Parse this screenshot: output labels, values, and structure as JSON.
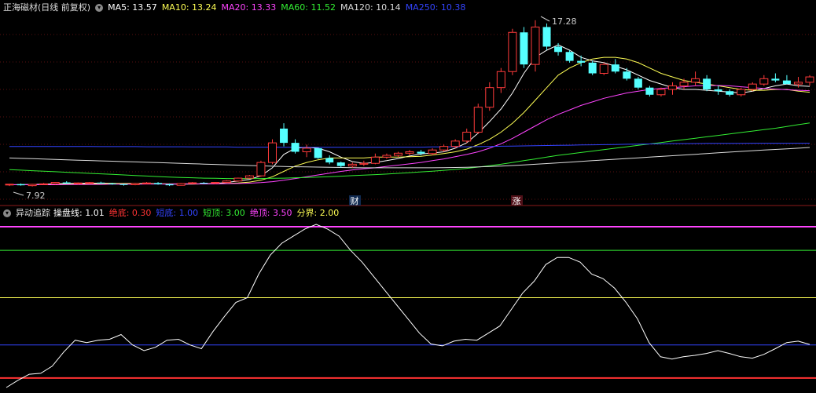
{
  "main_panel": {
    "title": "正海磁材(日线 前复权)",
    "indicators": [
      {
        "label": "MA5: 13.57",
        "color": "#ffffff"
      },
      {
        "label": "MA10: 13.24",
        "color": "#ffff55"
      },
      {
        "label": "MA20: 13.33",
        "color": "#ff44ff"
      },
      {
        "label": "MA60: 11.52",
        "color": "#33ee33"
      },
      {
        "label": "MA120: 10.14",
        "color": "#dddddd"
      },
      {
        "label": "MA250: 10.38",
        "color": "#3344ff"
      }
    ],
    "max_price_label": "17.28",
    "min_price_label": "7.92",
    "marker_cai": "财",
    "marker_zhang": "涨"
  },
  "sub_panel": {
    "title": "异动追踪",
    "indicators": [
      {
        "label": "操盘线: 1.01",
        "color": "#ffffff"
      },
      {
        "label": "绝底: 0.30",
        "color": "#ff3333"
      },
      {
        "label": "短底: 1.00",
        "color": "#3344ff"
      },
      {
        "label": "短顶: 3.00",
        "color": "#33ee33"
      },
      {
        "label": "绝顶: 3.50",
        "color": "#ff44ff"
      },
      {
        "label": "分界: 2.00",
        "color": "#ffff55"
      }
    ]
  },
  "chart_data": [
    {
      "type": "candlestick",
      "title": "正海磁材(日线 前复权)",
      "ylim": [
        7.5,
        17.8
      ],
      "candles": [
        [
          8.05,
          8.1,
          7.98,
          8.08
        ],
        [
          8.08,
          8.12,
          8.0,
          8.02
        ],
        [
          8.0,
          8.1,
          7.95,
          8.07
        ],
        [
          8.07,
          8.15,
          8.03,
          8.1
        ],
        [
          8.1,
          8.2,
          8.05,
          8.18
        ],
        [
          8.18,
          8.25,
          8.1,
          8.12
        ],
        [
          8.12,
          8.18,
          8.05,
          8.15
        ],
        [
          8.15,
          8.2,
          8.1,
          8.17
        ],
        [
          8.17,
          8.22,
          8.1,
          8.12
        ],
        [
          8.12,
          8.16,
          8.05,
          8.08
        ],
        [
          8.08,
          8.12,
          8.0,
          8.05
        ],
        [
          8.05,
          8.15,
          8.02,
          8.12
        ],
        [
          8.12,
          8.2,
          8.08,
          8.15
        ],
        [
          8.15,
          8.2,
          8.05,
          8.08
        ],
        [
          8.08,
          8.12,
          7.98,
          8.02
        ],
        [
          8.02,
          8.15,
          8.0,
          8.12
        ],
        [
          8.12,
          8.2,
          8.08,
          8.16
        ],
        [
          8.16,
          8.2,
          8.1,
          8.14
        ],
        [
          8.14,
          8.2,
          8.08,
          8.18
        ],
        [
          8.18,
          8.3,
          8.15,
          8.26
        ],
        [
          8.26,
          8.45,
          8.22,
          8.42
        ],
        [
          8.42,
          8.6,
          8.38,
          8.55
        ],
        [
          8.55,
          9.4,
          8.5,
          9.3
        ],
        [
          9.3,
          10.6,
          9.2,
          10.4
        ],
        [
          11.2,
          11.5,
          10.2,
          10.4
        ],
        [
          10.4,
          10.6,
          9.8,
          9.9
        ],
        [
          9.9,
          10.3,
          9.6,
          10.1
        ],
        [
          10.1,
          10.1,
          9.5,
          9.55
        ],
        [
          9.55,
          9.7,
          9.2,
          9.3
        ],
        [
          9.3,
          9.35,
          9.0,
          9.1
        ],
        [
          9.1,
          9.3,
          9.0,
          9.2
        ],
        [
          9.2,
          9.4,
          9.1,
          9.25
        ],
        [
          9.25,
          9.8,
          9.2,
          9.6
        ],
        [
          9.6,
          9.8,
          9.5,
          9.7
        ],
        [
          9.7,
          9.9,
          9.6,
          9.82
        ],
        [
          9.82,
          10.0,
          9.7,
          9.9
        ],
        [
          9.9,
          10.0,
          9.7,
          9.8
        ],
        [
          9.8,
          10.1,
          9.7,
          10.0
        ],
        [
          10.0,
          10.3,
          9.9,
          10.2
        ],
        [
          10.2,
          10.6,
          10.1,
          10.5
        ],
        [
          10.5,
          11.2,
          10.4,
          11.0
        ],
        [
          11.0,
          12.6,
          10.9,
          12.4
        ],
        [
          12.4,
          13.8,
          12.2,
          13.5
        ],
        [
          13.5,
          14.6,
          13.2,
          14.4
        ],
        [
          14.4,
          16.8,
          14.2,
          16.6
        ],
        [
          16.6,
          16.9,
          14.6,
          14.8
        ],
        [
          14.8,
          17.28,
          14.4,
          16.9
        ],
        [
          16.9,
          17.1,
          15.6,
          15.8
        ],
        [
          15.8,
          16.0,
          15.3,
          15.5
        ],
        [
          15.5,
          15.6,
          14.9,
          15.0
        ],
        [
          15.0,
          15.3,
          14.7,
          14.9
        ],
        [
          14.9,
          15.0,
          14.2,
          14.3
        ],
        [
          14.3,
          14.9,
          14.2,
          14.8
        ],
        [
          14.8,
          15.1,
          14.3,
          14.4
        ],
        [
          14.4,
          14.6,
          13.9,
          14.0
        ],
        [
          14.0,
          14.1,
          13.4,
          13.5
        ],
        [
          13.5,
          13.6,
          13.0,
          13.1
        ],
        [
          13.1,
          13.5,
          13.0,
          13.4
        ],
        [
          13.4,
          13.8,
          13.1,
          13.6
        ],
        [
          13.6,
          14.0,
          13.4,
          13.8
        ],
        [
          13.8,
          14.4,
          13.6,
          14.0
        ],
        [
          14.0,
          14.2,
          13.3,
          13.4
        ],
        [
          13.4,
          13.6,
          13.1,
          13.3
        ],
        [
          13.3,
          13.4,
          13.0,
          13.1
        ],
        [
          13.1,
          13.5,
          13.0,
          13.4
        ],
        [
          13.4,
          13.8,
          13.3,
          13.7
        ],
        [
          13.7,
          14.2,
          13.6,
          14.0
        ],
        [
          14.0,
          14.3,
          13.8,
          13.9
        ],
        [
          13.9,
          14.2,
          13.7,
          13.7
        ],
        [
          13.7,
          14.1,
          13.5,
          13.8
        ],
        [
          13.8,
          14.2,
          13.6,
          14.1
        ]
      ],
      "series": [
        {
          "name": "MA5",
          "color": "#ffffff",
          "values": [
            8.05,
            8.06,
            8.07,
            8.08,
            8.1,
            8.12,
            8.13,
            8.14,
            8.14,
            8.13,
            8.1,
            8.1,
            8.1,
            8.1,
            8.08,
            8.08,
            8.08,
            8.1,
            8.12,
            8.18,
            8.26,
            8.35,
            8.55,
            9.0,
            9.75,
            10.1,
            10.15,
            10.1,
            9.9,
            9.6,
            9.35,
            9.25,
            9.3,
            9.4,
            9.52,
            9.66,
            9.78,
            9.83,
            9.9,
            10.1,
            10.4,
            10.95,
            11.6,
            12.3,
            13.2,
            14.3,
            15.2,
            15.6,
            15.9,
            15.6,
            15.2,
            15.0,
            14.9,
            14.7,
            14.5,
            14.2,
            13.9,
            13.7,
            13.5,
            13.4,
            13.4,
            13.35,
            13.3,
            13.25,
            13.2,
            13.3,
            13.45,
            13.6,
            13.7,
            13.6,
            13.57
          ]
        },
        {
          "name": "MA10",
          "color": "#ffff55",
          "values": [
            8.05,
            8.05,
            8.05,
            8.06,
            8.07,
            8.08,
            8.09,
            8.1,
            8.11,
            8.12,
            8.12,
            8.12,
            8.12,
            8.11,
            8.1,
            8.1,
            8.1,
            8.1,
            8.11,
            8.12,
            8.15,
            8.2,
            8.3,
            8.5,
            8.8,
            9.1,
            9.3,
            9.45,
            9.55,
            9.55,
            9.55,
            9.55,
            9.6,
            9.6,
            9.6,
            9.62,
            9.65,
            9.72,
            9.8,
            9.9,
            10.05,
            10.3,
            10.6,
            11.0,
            11.5,
            12.1,
            12.8,
            13.5,
            14.2,
            14.6,
            14.9,
            15.1,
            15.2,
            15.2,
            15.1,
            14.9,
            14.6,
            14.3,
            14.1,
            13.9,
            13.8,
            13.7,
            13.6,
            13.5,
            13.4,
            13.35,
            13.35,
            13.4,
            13.4,
            13.3,
            13.24
          ]
        },
        {
          "name": "MA20",
          "color": "#ff44ff",
          "values": [
            8.05,
            8.05,
            8.05,
            8.05,
            8.05,
            8.06,
            8.06,
            8.07,
            8.07,
            8.08,
            8.08,
            8.08,
            8.09,
            8.09,
            8.09,
            8.1,
            8.1,
            8.1,
            8.1,
            8.11,
            8.12,
            8.14,
            8.17,
            8.22,
            8.3,
            8.4,
            8.5,
            8.6,
            8.7,
            8.8,
            8.88,
            8.95,
            9.0,
            9.08,
            9.15,
            9.22,
            9.3,
            9.4,
            9.5,
            9.62,
            9.75,
            9.9,
            10.1,
            10.35,
            10.65,
            11.0,
            11.35,
            11.7,
            12.0,
            12.25,
            12.5,
            12.7,
            12.9,
            13.05,
            13.2,
            13.3,
            13.4,
            13.45,
            13.5,
            13.55,
            13.6,
            13.62,
            13.62,
            13.6,
            13.55,
            13.5,
            13.45,
            13.42,
            13.38,
            13.35,
            13.33
          ]
        },
        {
          "name": "MA60",
          "color": "#33ee33",
          "values": [
            8.9,
            8.87,
            8.84,
            8.81,
            8.78,
            8.75,
            8.72,
            8.69,
            8.66,
            8.63,
            8.6,
            8.57,
            8.54,
            8.51,
            8.48,
            8.46,
            8.44,
            8.42,
            8.41,
            8.4,
            8.4,
            8.4,
            8.4,
            8.41,
            8.42,
            8.44,
            8.46,
            8.48,
            8.5,
            8.53,
            8.56,
            8.59,
            8.62,
            8.65,
            8.69,
            8.73,
            8.77,
            8.81,
            8.86,
            8.91,
            8.97,
            9.04,
            9.12,
            9.2,
            9.3,
            9.4,
            9.5,
            9.6,
            9.7,
            9.78,
            9.86,
            9.94,
            10.02,
            10.1,
            10.18,
            10.26,
            10.34,
            10.42,
            10.5,
            10.58,
            10.66,
            10.74,
            10.82,
            10.9,
            10.98,
            11.06,
            11.14,
            11.22,
            11.32,
            11.42,
            11.52
          ]
        },
        {
          "name": "MA120",
          "color": "#dddddd",
          "values": [
            9.55,
            9.53,
            9.51,
            9.49,
            9.47,
            9.45,
            9.43,
            9.41,
            9.39,
            9.37,
            9.35,
            9.33,
            9.31,
            9.29,
            9.27,
            9.25,
            9.23,
            9.21,
            9.19,
            9.17,
            9.15,
            9.13,
            9.11,
            9.09,
            9.07,
            9.06,
            9.05,
            9.04,
            9.03,
            9.02,
            9.01,
            9.0,
            9.0,
            9.0,
            9.0,
            9.0,
            9.0,
            9.0,
            9.01,
            9.02,
            9.03,
            9.05,
            9.07,
            9.1,
            9.13,
            9.16,
            9.2,
            9.24,
            9.28,
            9.32,
            9.36,
            9.4,
            9.44,
            9.48,
            9.52,
            9.56,
            9.6,
            9.64,
            9.68,
            9.72,
            9.76,
            9.8,
            9.84,
            9.88,
            9.92,
            9.96,
            10.0,
            10.03,
            10.06,
            10.1,
            10.14
          ]
        },
        {
          "name": "MA250",
          "color": "#3344ff",
          "values": [
            10.2,
            10.2,
            10.2,
            10.2,
            10.2,
            10.2,
            10.2,
            10.2,
            10.19,
            10.19,
            10.19,
            10.19,
            10.18,
            10.18,
            10.18,
            10.18,
            10.17,
            10.17,
            10.17,
            10.17,
            10.16,
            10.16,
            10.16,
            10.16,
            10.15,
            10.15,
            10.15,
            10.15,
            10.15,
            10.15,
            10.15,
            10.15,
            10.15,
            10.15,
            10.16,
            10.16,
            10.16,
            10.17,
            10.17,
            10.18,
            10.18,
            10.19,
            10.2,
            10.21,
            10.22,
            10.23,
            10.24,
            10.25,
            10.26,
            10.27,
            10.28,
            10.29,
            10.3,
            10.31,
            10.32,
            10.33,
            10.34,
            10.35,
            10.36,
            10.36,
            10.36,
            10.37,
            10.37,
            10.37,
            10.37,
            10.38,
            10.38,
            10.38,
            10.38,
            10.38,
            10.38
          ]
        }
      ]
    },
    {
      "type": "line",
      "title": "异动追踪",
      "ylim": [
        0.0,
        3.65
      ],
      "reference_lines": [
        {
          "name": "绝顶",
          "value": 3.5,
          "color": "#ff44ff"
        },
        {
          "name": "短顶",
          "value": 3.0,
          "color": "#33ee33"
        },
        {
          "name": "分界",
          "value": 2.0,
          "color": "#ffff55"
        },
        {
          "name": "短底",
          "value": 1.0,
          "color": "#3344ff"
        },
        {
          "name": "绝底",
          "value": 0.3,
          "color": "#ff3333"
        }
      ],
      "series": [
        {
          "name": "操盘线",
          "color": "#ffffff",
          "values": [
            0.1,
            0.25,
            0.38,
            0.4,
            0.55,
            0.85,
            1.1,
            1.05,
            1.1,
            1.12,
            1.22,
            1.0,
            0.88,
            0.95,
            1.1,
            1.12,
            1.0,
            0.92,
            1.28,
            1.6,
            1.9,
            2.0,
            2.5,
            2.9,
            3.15,
            3.3,
            3.45,
            3.55,
            3.45,
            3.3,
            3.0,
            2.75,
            2.45,
            2.15,
            1.85,
            1.55,
            1.25,
            1.02,
            0.98,
            1.08,
            1.12,
            1.1,
            1.25,
            1.4,
            1.75,
            2.1,
            2.35,
            2.7,
            2.85,
            2.85,
            2.75,
            2.5,
            2.4,
            2.2,
            1.9,
            1.55,
            1.05,
            0.75,
            0.7,
            0.75,
            0.78,
            0.82,
            0.88,
            0.82,
            0.75,
            0.72,
            0.8,
            0.92,
            1.05,
            1.08,
            1.01
          ]
        }
      ]
    }
  ]
}
